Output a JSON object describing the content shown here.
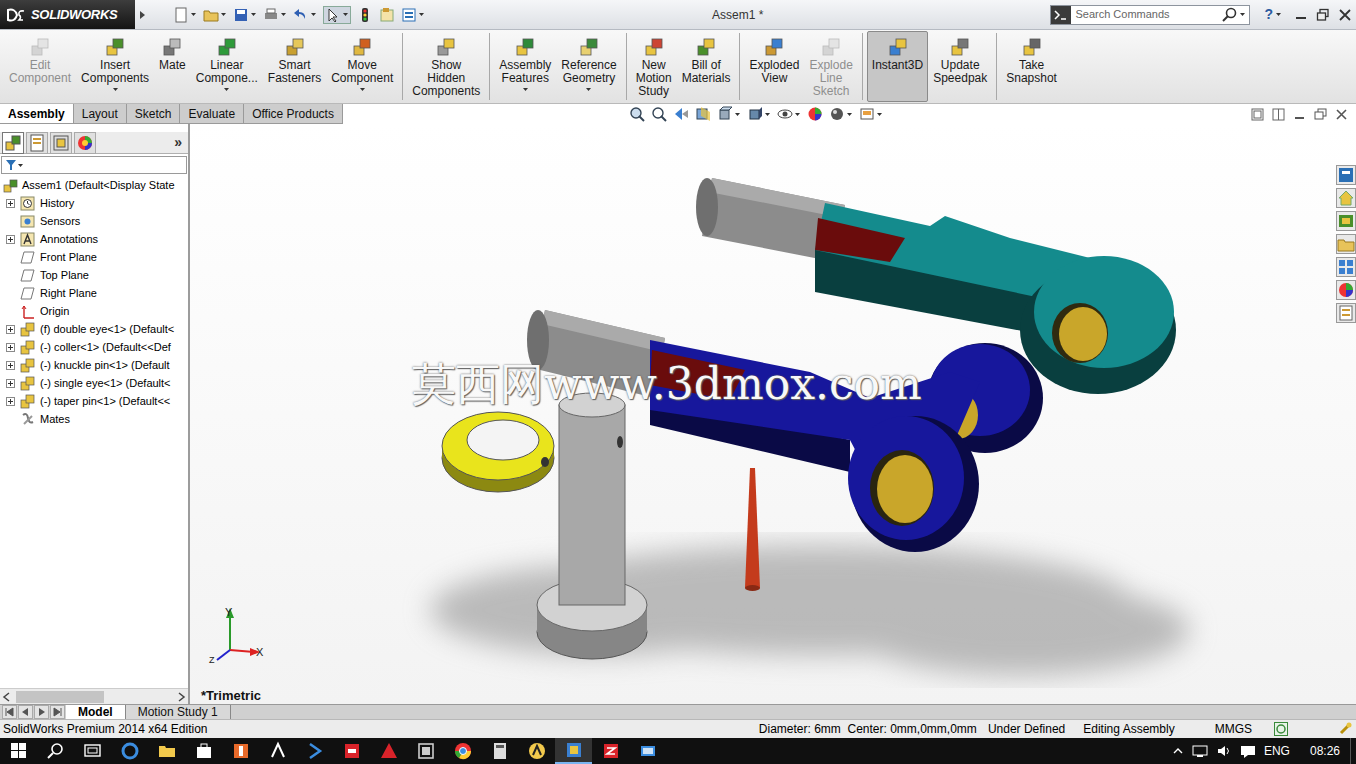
{
  "app": {
    "logo": "SOLIDWORKS",
    "title": "Assem1 *",
    "help": "?"
  },
  "search": {
    "placeholder": "Search Commands"
  },
  "ribbon": [
    [
      {
        "lines": [
          "Edit",
          "Component"
        ],
        "disabled": true,
        "selected": false,
        "dropdown": false
      },
      {
        "lines": [
          "Insert",
          "Components"
        ],
        "disabled": false,
        "selected": false,
        "dropdown": true
      },
      {
        "lines": [
          "Mate"
        ],
        "disabled": false,
        "selected": false,
        "dropdown": false
      },
      {
        "lines": [
          "Linear",
          "Compone..."
        ],
        "disabled": false,
        "selected": false,
        "dropdown": true
      },
      {
        "lines": [
          "Smart",
          "Fasteners"
        ],
        "disabled": false,
        "selected": false,
        "dropdown": false
      },
      {
        "lines": [
          "Move",
          "Component"
        ],
        "disabled": false,
        "selected": false,
        "dropdown": true
      }
    ],
    [
      {
        "lines": [
          "Show",
          "Hidden",
          "Components"
        ],
        "disabled": false,
        "selected": false,
        "dropdown": false
      }
    ],
    [
      {
        "lines": [
          "Assembly",
          "Features"
        ],
        "disabled": false,
        "selected": false,
        "dropdown": true
      },
      {
        "lines": [
          "Reference",
          "Geometry"
        ],
        "disabled": false,
        "selected": false,
        "dropdown": true
      }
    ],
    [
      {
        "lines": [
          "New",
          "Motion",
          "Study"
        ],
        "disabled": false,
        "selected": false,
        "dropdown": false
      },
      {
        "lines": [
          "Bill of",
          "Materials"
        ],
        "disabled": false,
        "selected": false,
        "dropdown": false
      }
    ],
    [
      {
        "lines": [
          "Exploded",
          "View"
        ],
        "disabled": false,
        "selected": false,
        "dropdown": false
      },
      {
        "lines": [
          "Explode",
          "Line",
          "Sketch"
        ],
        "disabled": true,
        "selected": false,
        "dropdown": false
      }
    ],
    [
      {
        "lines": [
          "Instant3D"
        ],
        "disabled": false,
        "selected": true,
        "dropdown": false
      },
      {
        "lines": [
          "Update",
          "Speedpak"
        ],
        "disabled": false,
        "selected": false,
        "dropdown": false
      }
    ],
    [
      {
        "lines": [
          "Take",
          "Snapshot"
        ],
        "disabled": false,
        "selected": false,
        "dropdown": false
      }
    ]
  ],
  "tabs": [
    {
      "label": "Assembly",
      "selected": true
    },
    {
      "label": "Layout",
      "selected": false
    },
    {
      "label": "Sketch",
      "selected": false
    },
    {
      "label": "Evaluate",
      "selected": false
    },
    {
      "label": "Office Products",
      "selected": false
    }
  ],
  "panel": {
    "more": "»"
  },
  "tree": [
    {
      "label": "Assem1  (Default<Display State",
      "kind": "assembly",
      "expandable": false,
      "expanded": true
    },
    {
      "label": "History",
      "kind": "history",
      "expandable": true,
      "expanded": false
    },
    {
      "label": "Sensors",
      "kind": "sensor",
      "expandable": false,
      "expanded": false
    },
    {
      "label": "Annotations",
      "kind": "annotation",
      "expandable": true,
      "expanded": false
    },
    {
      "label": "Front Plane",
      "kind": "plane",
      "expandable": false,
      "expanded": false
    },
    {
      "label": "Top Plane",
      "kind": "plane",
      "expandable": false,
      "expanded": false
    },
    {
      "label": "Right Plane",
      "kind": "plane",
      "expandable": false,
      "expanded": false
    },
    {
      "label": "Origin",
      "kind": "origin",
      "expandable": false,
      "expanded": false
    },
    {
      "label": "(f) double eye<1> (Default<",
      "kind": "part",
      "expandable": true,
      "expanded": false
    },
    {
      "label": "(-) coller<1> (Default<<Def",
      "kind": "part",
      "expandable": true,
      "expanded": false
    },
    {
      "label": "(-) knuckle pin<1> (Default",
      "kind": "part",
      "expandable": true,
      "expanded": false
    },
    {
      "label": "(-) single eye<1> (Default<",
      "kind": "part",
      "expandable": true,
      "expanded": false
    },
    {
      "label": "(-) taper pin<1> (Default<<",
      "kind": "part",
      "expandable": true,
      "expanded": false
    },
    {
      "label": "Mates",
      "kind": "mates",
      "expandable": false,
      "expanded": false
    }
  ],
  "viewport": {
    "watermark": "莫西网www.3dmox.com",
    "view": "*Trimetric",
    "axes": {
      "y": "Y",
      "x": "X",
      "z": "Z"
    }
  },
  "parts": [
    {
      "kind": "single-eye",
      "color": "#148b8d"
    },
    {
      "kind": "double-eye",
      "color": "#17179c"
    },
    {
      "kind": "collar",
      "color": "#e9e41c"
    },
    {
      "kind": "knuckle-pin",
      "color": "#a8a8a8"
    },
    {
      "kind": "taper-pin",
      "color": "#c43b1c"
    }
  ],
  "bottom_tabs": [
    {
      "label": "Model",
      "selected": true
    },
    {
      "label": "Motion Study 1",
      "selected": false
    }
  ],
  "status": {
    "edition": "SolidWorks Premium 2014 x64 Edition",
    "measure": "Diameter: 6mm  Center: 0mm,0mm,0mm",
    "state": "Under Defined",
    "mode": "Editing Assembly",
    "units": "MMGS"
  },
  "taskbar": {
    "language": "ENG",
    "time": "08:26"
  }
}
